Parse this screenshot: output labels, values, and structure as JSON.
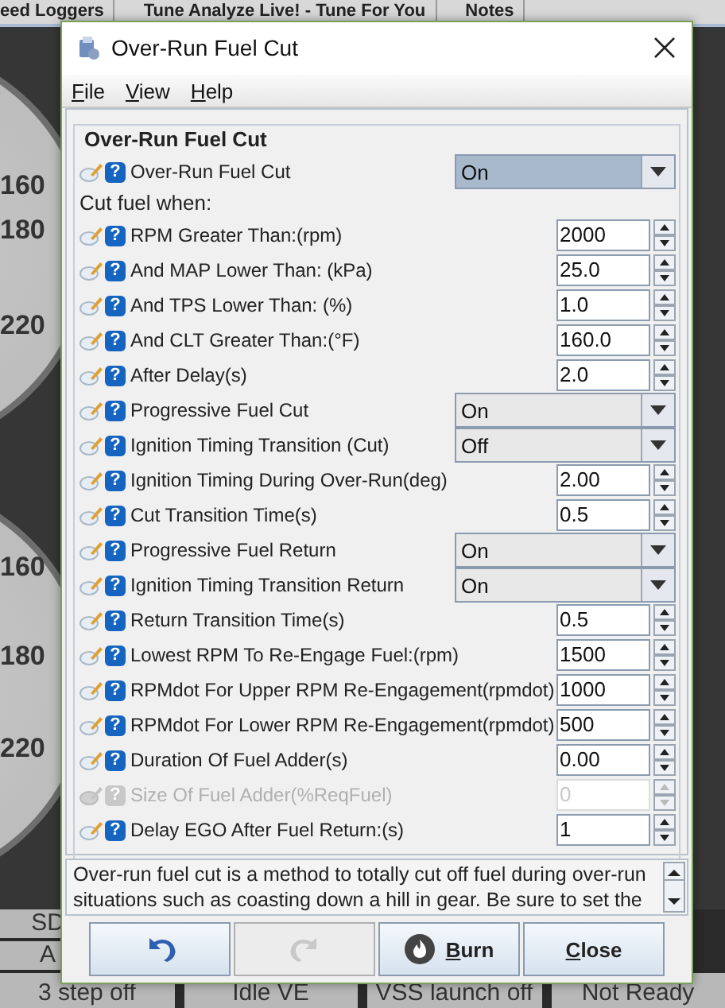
{
  "background": {
    "tabs": [
      "eed Loggers",
      "Tune Analyze Live! - Tune For You",
      "Notes"
    ],
    "gauge_labels": [
      "160",
      "180",
      "220",
      "160",
      "180",
      "220"
    ],
    "indicator_rows": [
      [
        "SD"
      ],
      [
        "A"
      ],
      [
        "3 step off",
        "Idle VE",
        "VSS launch off",
        "Not Ready"
      ]
    ]
  },
  "dialog": {
    "title": "Over-Run Fuel Cut",
    "menu": [
      "File",
      "View",
      "Help"
    ],
    "section_title": "Over-Run Fuel Cut",
    "rows": [
      {
        "kind": "select",
        "help": "?",
        "label": "Over-Run Fuel Cut",
        "value": "On",
        "focused": true,
        "disabled": false
      },
      {
        "kind": "heading",
        "label": "Cut fuel when:"
      },
      {
        "kind": "spinner",
        "help": "?",
        "label": "RPM Greater Than:(rpm)",
        "value": "2000",
        "disabled": false
      },
      {
        "kind": "spinner",
        "help": "?",
        "label": "And MAP Lower Than:  (kPa)",
        "value": "25.0",
        "disabled": false
      },
      {
        "kind": "spinner",
        "help": "?",
        "label": "And TPS Lower Than:  (%)",
        "value": "1.0",
        "disabled": false
      },
      {
        "kind": "spinner",
        "help": "?",
        "label": "And CLT Greater Than:(°F)",
        "value": "160.0",
        "disabled": false
      },
      {
        "kind": "spinner",
        "help": "?",
        "label": "After Delay(s)",
        "value": "2.0",
        "disabled": false
      },
      {
        "kind": "select",
        "help": "?",
        "label": "Progressive Fuel Cut",
        "value": "On",
        "focused": false,
        "disabled": false
      },
      {
        "kind": "select",
        "help": "?",
        "label": "Ignition Timing Transition (Cut)",
        "value": "Off",
        "focused": false,
        "disabled": false
      },
      {
        "kind": "spinner",
        "help": "?",
        "label": "Ignition Timing During Over-Run(deg)",
        "value": "2.00",
        "disabled": false
      },
      {
        "kind": "spinner",
        "help": "?",
        "label": "Cut Transition Time(s)",
        "value": "0.5",
        "disabled": false
      },
      {
        "kind": "select",
        "help": "?",
        "label": "Progressive Fuel Return",
        "value": "On",
        "focused": false,
        "disabled": false
      },
      {
        "kind": "select",
        "help": "?",
        "label": "Ignition Timing Transition Return",
        "value": "On",
        "focused": false,
        "disabled": false
      },
      {
        "kind": "spinner",
        "help": "?",
        "label": "Return Transition Time(s)",
        "value": "0.5",
        "disabled": false
      },
      {
        "kind": "spinner",
        "help": "?",
        "label": "Lowest RPM To Re-Engage Fuel:(rpm)",
        "value": "1500",
        "disabled": false
      },
      {
        "kind": "spinner",
        "help": "?",
        "label": "RPMdot For Upper RPM Re-Engagement(rpmdot)",
        "value": "1000",
        "disabled": false
      },
      {
        "kind": "spinner",
        "help": "?",
        "label": "RPMdot For Lower RPM Re-Engagement(rpmdot)",
        "value": "500",
        "disabled": false
      },
      {
        "kind": "spinner",
        "help": "?",
        "label": "Duration Of Fuel Adder(s)",
        "value": "0.00",
        "disabled": false
      },
      {
        "kind": "spinner",
        "help": "?",
        "label": "Size Of Fuel Adder(%ReqFuel)",
        "value": "0",
        "disabled": true
      },
      {
        "kind": "spinner",
        "help": "?",
        "label": "Delay EGO After Fuel Return:(s)",
        "value": "1",
        "disabled": false
      }
    ],
    "help_text": "Over-run fuel cut is a method to totally cut off fuel during over-run situations such as coasting down a hill in gear. Be sure to set the",
    "buttons": [
      {
        "kind": "undo",
        "disabled": false
      },
      {
        "kind": "redo",
        "disabled": true
      },
      {
        "kind": "burn",
        "label": "Burn",
        "disabled": false
      },
      {
        "kind": "close",
        "label": "Close",
        "disabled": false
      }
    ]
  }
}
